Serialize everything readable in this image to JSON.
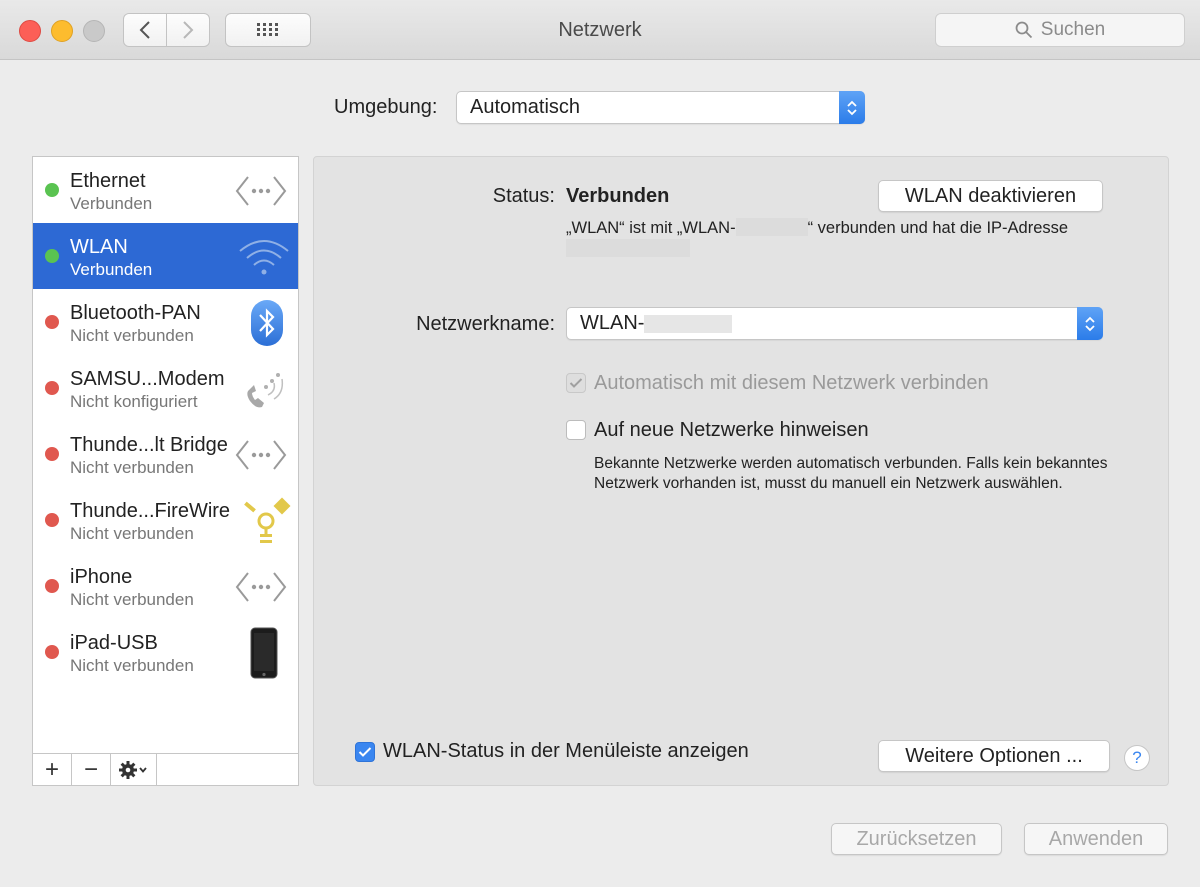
{
  "window": {
    "title": "Netzwerk"
  },
  "toolbar": {
    "search_placeholder": "Suchen"
  },
  "location": {
    "label": "Umgebung:",
    "value": "Automatisch"
  },
  "services": [
    {
      "name": "Ethernet",
      "status": "Verbunden",
      "connected": true,
      "icon": "ethernet-icon"
    },
    {
      "name": "WLAN",
      "status": "Verbunden",
      "connected": true,
      "icon": "wifi-icon",
      "selected": true
    },
    {
      "name": "Bluetooth-PAN",
      "status": "Nicht verbunden",
      "connected": false,
      "icon": "bluetooth-icon"
    },
    {
      "name": "SAMSU...Modem",
      "status": "Nicht konfiguriert",
      "connected": false,
      "icon": "modem-phone-icon"
    },
    {
      "name": "Thunde...lt Bridge",
      "status": "Nicht verbunden",
      "connected": false,
      "icon": "ethernet-icon"
    },
    {
      "name": "Thunde...FireWire",
      "status": "Nicht verbunden",
      "connected": false,
      "icon": "firewire-icon"
    },
    {
      "name": "iPhone",
      "status": "Nicht verbunden",
      "connected": false,
      "icon": "ethernet-icon"
    },
    {
      "name": "iPad-USB",
      "status": "Nicht verbunden",
      "connected": false,
      "icon": "ipad-icon"
    }
  ],
  "sidebar_footer": {
    "add": "+",
    "remove": "−"
  },
  "detail": {
    "status_label": "Status:",
    "status_value": "Verbunden",
    "toggle_button": "WLAN deaktivieren",
    "desc_part1": "„WLAN“ ist mit „WLAN-",
    "desc_part2": "“ verbunden und hat die IP-Adresse",
    "network_label": "Netzwerkname:",
    "network_value": "WLAN-",
    "auto_join_label": "Automatisch mit diesem Netzwerk verbinden",
    "ask_new_label": "Auf neue Netzwerke hinweisen",
    "hint": "Bekannte Netzwerke werden automatisch verbunden. Falls kein bekanntes Netzwerk vorhanden ist, musst du manuell ein Netzwerk auswählen.",
    "menubar_label": "WLAN-Status in der Menüleiste anzeigen",
    "advanced_button": "Weitere Optionen ...",
    "help": "?"
  },
  "footer": {
    "revert": "Zurücksetzen",
    "apply": "Anwenden"
  },
  "colors": {
    "connected": "#5ac351",
    "disconnected": "#e0584f",
    "selection": "#2d69d4",
    "accent": "#3a86f0"
  }
}
